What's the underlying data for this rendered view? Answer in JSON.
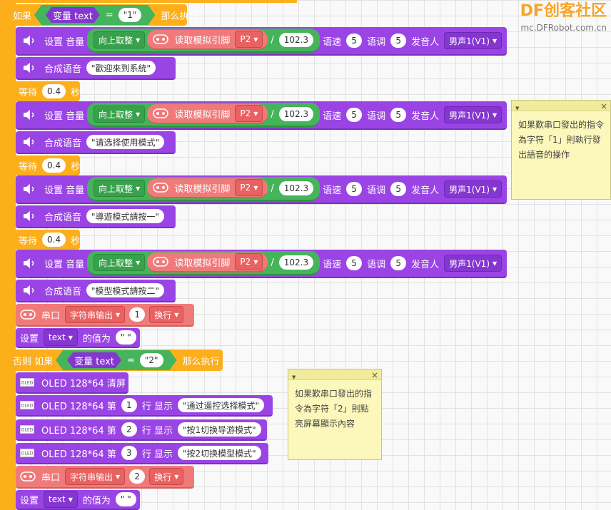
{
  "watermark": {
    "logo_df": "DF",
    "logo_text": "创客社区",
    "site": "mc.DFRobot.com.cn"
  },
  "if_block": {
    "if_label": "如果",
    "var_label": "变量 text",
    "eq": "=",
    "value": "\"1\"",
    "then_label": "那么执行"
  },
  "volume_row": {
    "set_label": "设置 音量",
    "round_label": "向上取整",
    "read_label": "读取模拟引脚",
    "pin": "P2",
    "divide": "/",
    "divisor": "102.3",
    "speed_label": "语速",
    "speed": "5",
    "tone_label": "语调",
    "tone": "5",
    "speaker_label": "发音人",
    "speaker": "男声1(V1)"
  },
  "speech_label": "合成语音",
  "speech": [
    "\"歡迎來到系統\"",
    "\"请选择使用模式\"",
    "\"導遊模式請按一\"",
    "\"模型模式請按二\""
  ],
  "wait": {
    "label": "等待",
    "value": "0.4",
    "unit": "秒"
  },
  "serial": {
    "label": "串口",
    "mode": "字符串输出",
    "value1": "1",
    "value2": "2",
    "newline": "换行"
  },
  "set_var": {
    "label": "设置",
    "var": "text",
    "value_label": "的值为",
    "value": "\" \""
  },
  "elseif": {
    "label": "否则 如果",
    "var_label": "变量 text",
    "eq": "=",
    "value": "\"2\"",
    "then_label": "那么执行",
    "minus": "−"
  },
  "oled": {
    "clear": "OLED 128*64 清屏",
    "prefix": "OLED 128*64 第",
    "row_suffix": "行 显示",
    "lines": [
      {
        "row": "1",
        "text": "\"通过遥控选择模式\""
      },
      {
        "row": "2",
        "text": "\"按1切换导游模式\""
      },
      {
        "row": "3",
        "text": "\"按2切换模型模式\""
      }
    ],
    "icon_text": "OLED"
  },
  "notes": [
    {
      "text": "如果歎串口發出的指令為字符「1」則執行發出語音的操作"
    },
    {
      "text": "如果歎串口發出的指令為字符「2」則點亮屏幕顯示內容"
    }
  ],
  "colors": {
    "control": "#fdae1b",
    "speech_block": "#9b44e6",
    "math_block": "#46b45a",
    "pin_block": "#f07a7a",
    "note": "#fcf8bb"
  }
}
